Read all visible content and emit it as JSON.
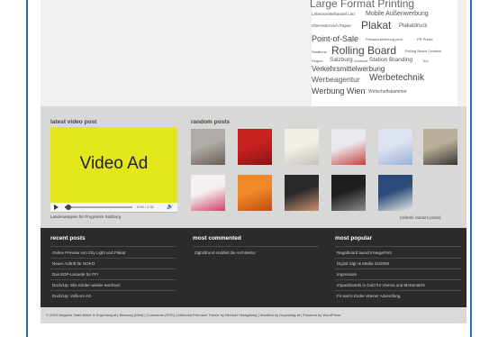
{
  "tag_cloud": [
    {
      "text": "Large Format Printing"
    },
    {
      "text": "Lebensmittelhandel Linz"
    },
    {
      "text": "Mobile Außenwerbung"
    },
    {
      "text": "Oberösterreich Papier"
    },
    {
      "text": "Plakat"
    },
    {
      "text": "Plakatdruck"
    },
    {
      "text": "Point-of-Sale"
    },
    {
      "text": "Pressezulieferung print"
    },
    {
      "text": "PR Public"
    },
    {
      "text": "Relations"
    },
    {
      "text": "Rolling Board"
    },
    {
      "text": "Rolling Board Creative"
    },
    {
      "text": "Region"
    },
    {
      "text": "Salzburg"
    },
    {
      "text": "Schlecht"
    },
    {
      "text": "Station Branding"
    },
    {
      "text": "Trio"
    },
    {
      "text": "Verkehrsmittelwerbung"
    },
    {
      "text": "Werbeagentur"
    },
    {
      "text": "Werbetechnik"
    },
    {
      "text": "Werbung Wien"
    },
    {
      "text": "Wirtschaftskammer"
    }
  ],
  "video": {
    "section_title": "latest video post",
    "ad_text": "Video Ad",
    "time": "0:00 / 2:31",
    "progress": 0.02,
    "caption": "Landeswappen für Programm Salzburg"
  },
  "random_posts": {
    "section_title": "random posts",
    "refresh_label": "(refresh random posts)",
    "thumbs": [
      {
        "colors": [
          "#b0aba6",
          "#6a5f58"
        ]
      },
      {
        "colors": [
          "#c8221f",
          "#8a1412"
        ]
      },
      {
        "colors": [
          "#f1efe8",
          "#c5c3bc"
        ]
      },
      {
        "colors": [
          "#e8e8ee",
          "#c84040"
        ]
      },
      {
        "colors": [
          "#dde2f0",
          "#9ab0d8"
        ]
      },
      {
        "colors": [
          "#b8b09a",
          "#3a3430"
        ]
      },
      {
        "colors": [
          "#f4f0f0",
          "#d0406a"
        ]
      },
      {
        "colors": [
          "#f08a28",
          "#c04c10"
        ]
      },
      {
        "colors": [
          "#2a2a2a",
          "#c89070"
        ]
      },
      {
        "colors": [
          "#1f1f1f",
          "#8a8a8a"
        ]
      },
      {
        "colors": [
          "#2c4b7a",
          "#e8e8e8"
        ]
      }
    ]
  },
  "recent_posts": {
    "title": "recent posts",
    "items": [
      "Online Preview von City Light und Plakat",
      "Neuer Auftritt für NOKO",
      "Das EDP-Lenarde für FFI",
      "Doch/Up: Wie Kinder wieder wachsen",
      "Doch/Up: Vollkorn AG"
    ]
  },
  "most_commented": {
    "title": "most commented",
    "items": [
      "Zigbildrund enddeit die Architektur"
    ]
  },
  "most_popular": {
    "title": "most popular",
    "items": [
      "Regalboard launcht MegaPrint",
      "Digital Sign & Media 22/2008",
      "Impressum",
      "Impactboards in Gold für Vienna und McDonald's",
      "Fit sein's Ender-Wiener Adventfang"
    ]
  },
  "footer": {
    "copyright": "© 2010 Magazin Stahl-Meier & Drgunslag.at | Birlsweg (Welt) | Comments (RSS) | Arthemia Premium Theme by Michael Hutagalung | Modified by Drgunslag.at | Powered by WordPress"
  }
}
